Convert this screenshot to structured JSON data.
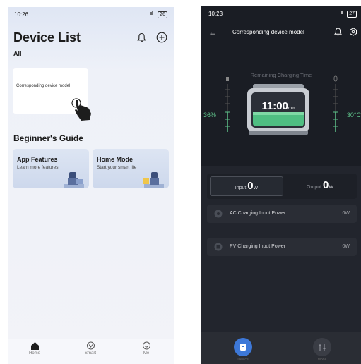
{
  "left_screen": {
    "status": {
      "time": "10:26",
      "signal": ".ııl",
      "battery": "26"
    },
    "title": "Device List",
    "filter": "All",
    "device_card": {
      "name": "Corresponding device model"
    },
    "guide": {
      "title": "Beginner's Guide",
      "cards": [
        {
          "title": "App Features",
          "subtitle": "Learn more features"
        },
        {
          "title": "Home Mode",
          "subtitle": "Start your smart life"
        }
      ]
    },
    "nav": {
      "home": "Home",
      "smart": "Smart",
      "me": "Me"
    }
  },
  "right_screen": {
    "status": {
      "time": "10:23",
      "signal": ".ııl",
      "battery": "27"
    },
    "title": "Corresponding device model",
    "remaining_label": "Remaining Charging Time",
    "time_value": "11:00",
    "time_unit": "min",
    "battery_percent": "36%",
    "temperature": "30°C",
    "io": {
      "input_label": "Input",
      "input_value": "0",
      "input_unit": "W",
      "output_label": "Output",
      "output_value": "0",
      "output_unit": "W"
    },
    "rows": [
      {
        "label": "AC Charging Input Power",
        "value": "0W"
      },
      {
        "label": "PV Charging Input Power",
        "value": "0W"
      }
    ],
    "nav": {
      "device": "Device",
      "other": "Mode"
    }
  },
  "colors": {
    "accent_green": "#5fc28a",
    "accent_blue": "#3d78d8",
    "dark_bg": "#1a1d24"
  }
}
